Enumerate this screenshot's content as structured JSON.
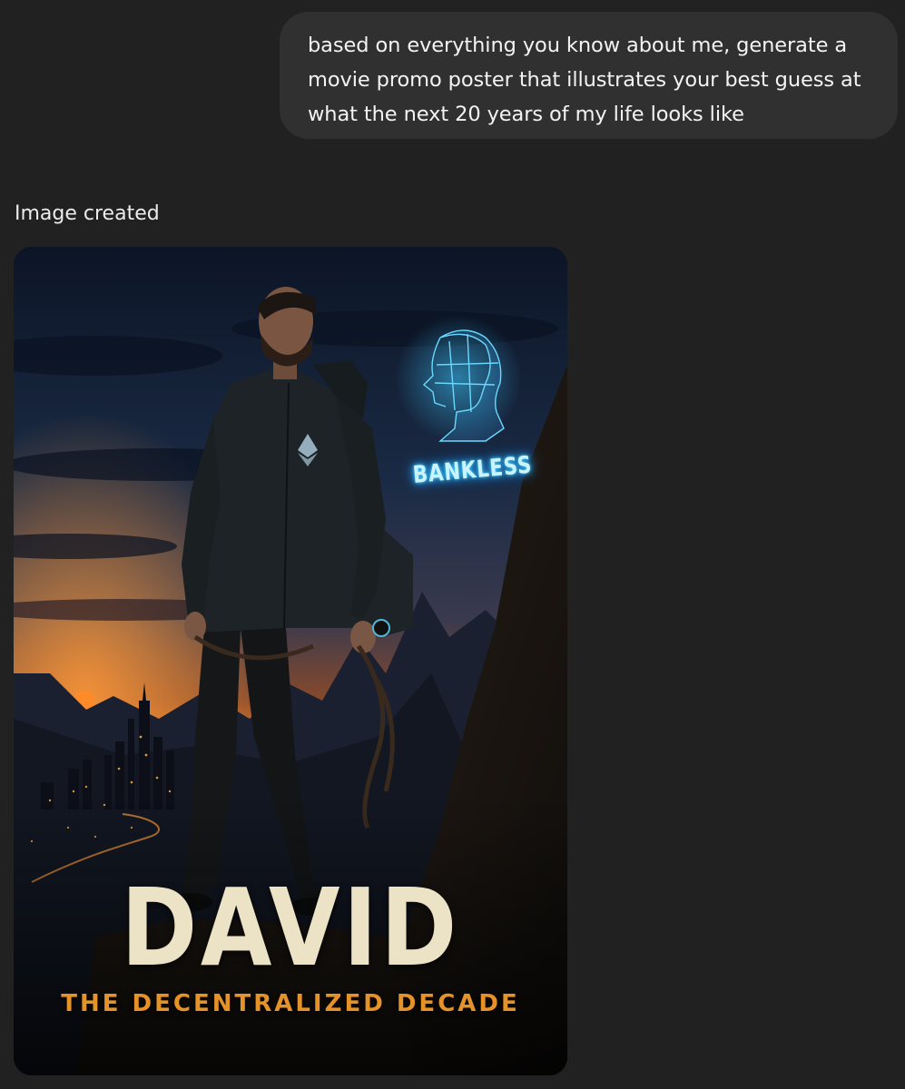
{
  "conversation": {
    "user_message": "based on everything you know about me, generate a movie promo poster that illustrates your best guess at what the next 20 years of my life looks like",
    "assistant_status": "Image created"
  },
  "poster": {
    "title": "DAVID",
    "subtitle": "THE DECENTRALIZED DECADE",
    "neon_sign": "BANKLESS",
    "colors": {
      "title": "#ece2c6",
      "subtitle": "#e59328",
      "neon": "#4fd6ff",
      "sky_top": "#0e1a2e",
      "sunset": "#e07a2a"
    }
  }
}
